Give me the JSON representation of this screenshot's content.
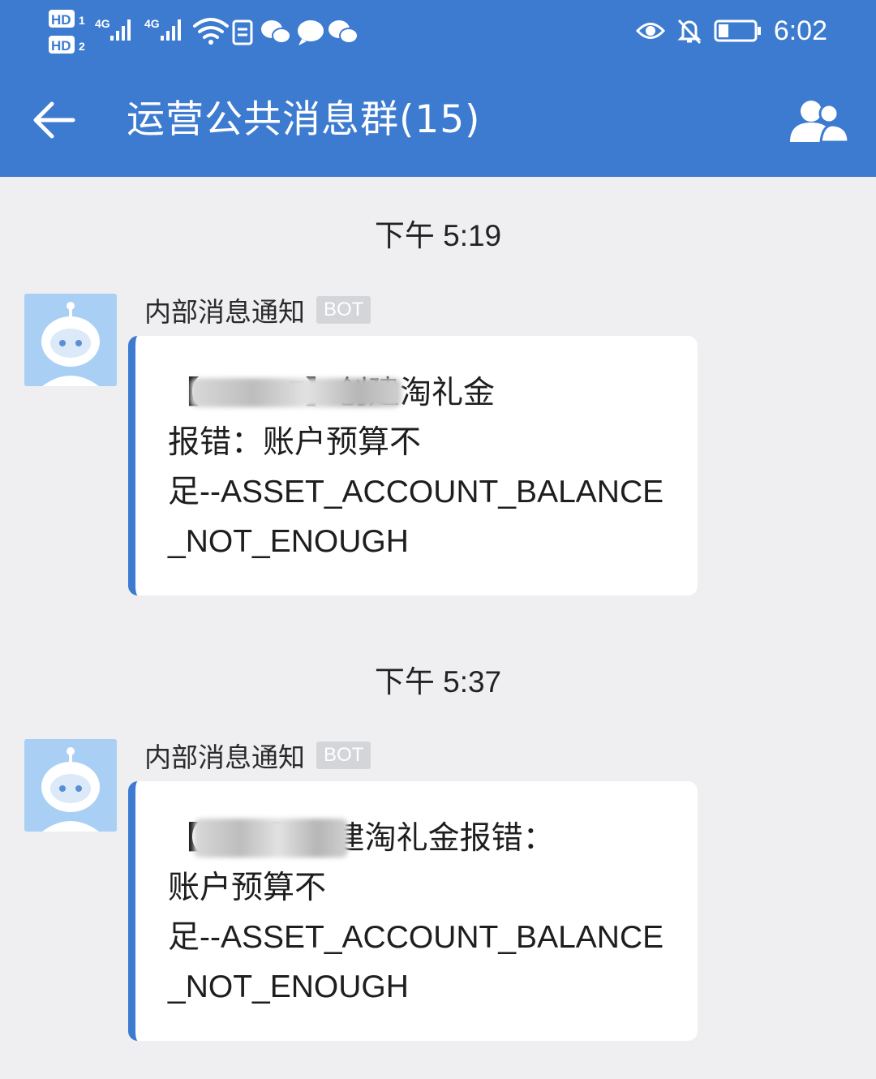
{
  "status_bar": {
    "left_labels": [
      "HD",
      "1",
      "HD",
      "2",
      "4G",
      "4G"
    ],
    "time": "6:02",
    "icons": [
      "signal-icon",
      "wifi-icon",
      "file-icon",
      "wechat-icon",
      "chat-bubble-icon",
      "wechat-icon",
      "eye-icon",
      "mute-bell-icon",
      "battery-icon"
    ]
  },
  "header": {
    "title": "运营公共消息群(15)",
    "back_icon": "arrow-left-icon",
    "members_icon": "group-members-icon",
    "bg_color": "#3d7bd0"
  },
  "messages": [
    {
      "timestamp": "下午 5:19",
      "sender": "内部消息通知",
      "badge": "BOT",
      "text": "【          7】创建淘礼金\n报错：账户预算不\n足--ASSET_ACCOUNT_BALANCE\n_NOT_ENOUGH"
    },
    {
      "timestamp": "下午 5:37",
      "sender": "内部消息通知",
      "badge": "BOT",
      "text": "【        】创建淘礼金报错：\n账户预算不\n足--ASSET_ACCOUNT_BALANCE\n_NOT_ENOUGH"
    }
  ]
}
